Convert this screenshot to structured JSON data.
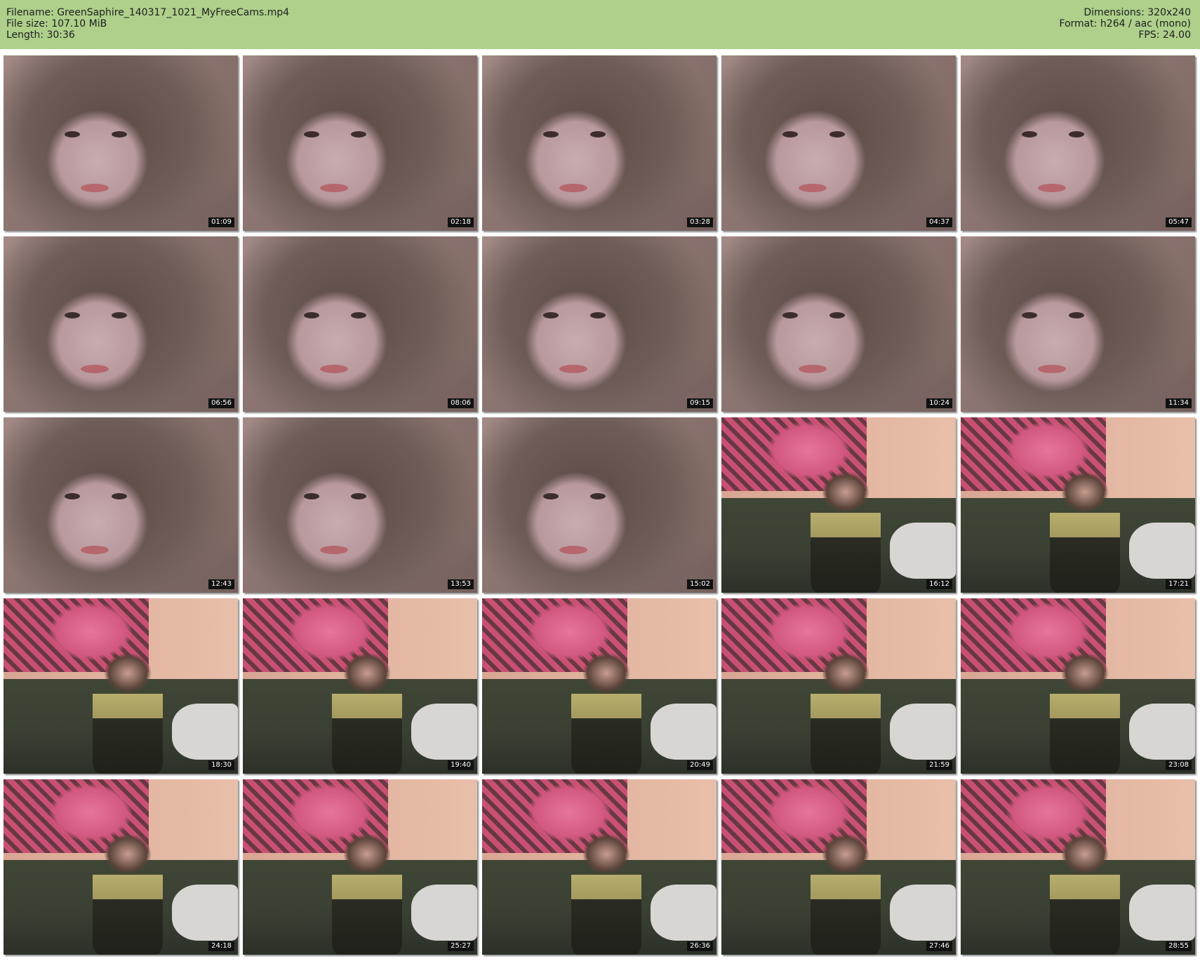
{
  "header": {
    "filename": "Filename: GreenSaphire_140317_1021_MyFreeCams.mp4",
    "filesize": "File size: 107.10 MiB",
    "length": "Length: 30:36",
    "dimensions": "Dimensions: 320x240",
    "format": "Format: h264 / aac (mono)",
    "fps": "FPS: 24.00"
  },
  "colors": {
    "header_bg": "#aed08b",
    "timestamp_bg": "#111111"
  },
  "thumbnails": [
    {
      "time": "01:09",
      "scene": "face"
    },
    {
      "time": "02:18",
      "scene": "face"
    },
    {
      "time": "03:28",
      "scene": "face"
    },
    {
      "time": "04:37",
      "scene": "face"
    },
    {
      "time": "05:47",
      "scene": "face"
    },
    {
      "time": "06:56",
      "scene": "face"
    },
    {
      "time": "08:06",
      "scene": "face"
    },
    {
      "time": "09:15",
      "scene": "face"
    },
    {
      "time": "10:24",
      "scene": "face"
    },
    {
      "time": "11:34",
      "scene": "face"
    },
    {
      "time": "12:43",
      "scene": "face"
    },
    {
      "time": "13:53",
      "scene": "face"
    },
    {
      "time": "15:02",
      "scene": "face"
    },
    {
      "time": "16:12",
      "scene": "room"
    },
    {
      "time": "17:21",
      "scene": "room"
    },
    {
      "time": "18:30",
      "scene": "room"
    },
    {
      "time": "19:40",
      "scene": "room"
    },
    {
      "time": "20:49",
      "scene": "room"
    },
    {
      "time": "21:59",
      "scene": "room"
    },
    {
      "time": "23:08",
      "scene": "room"
    },
    {
      "time": "24:18",
      "scene": "room"
    },
    {
      "time": "25:27",
      "scene": "room"
    },
    {
      "time": "26:36",
      "scene": "room"
    },
    {
      "time": "27:46",
      "scene": "room"
    },
    {
      "time": "28:55",
      "scene": "room"
    }
  ]
}
